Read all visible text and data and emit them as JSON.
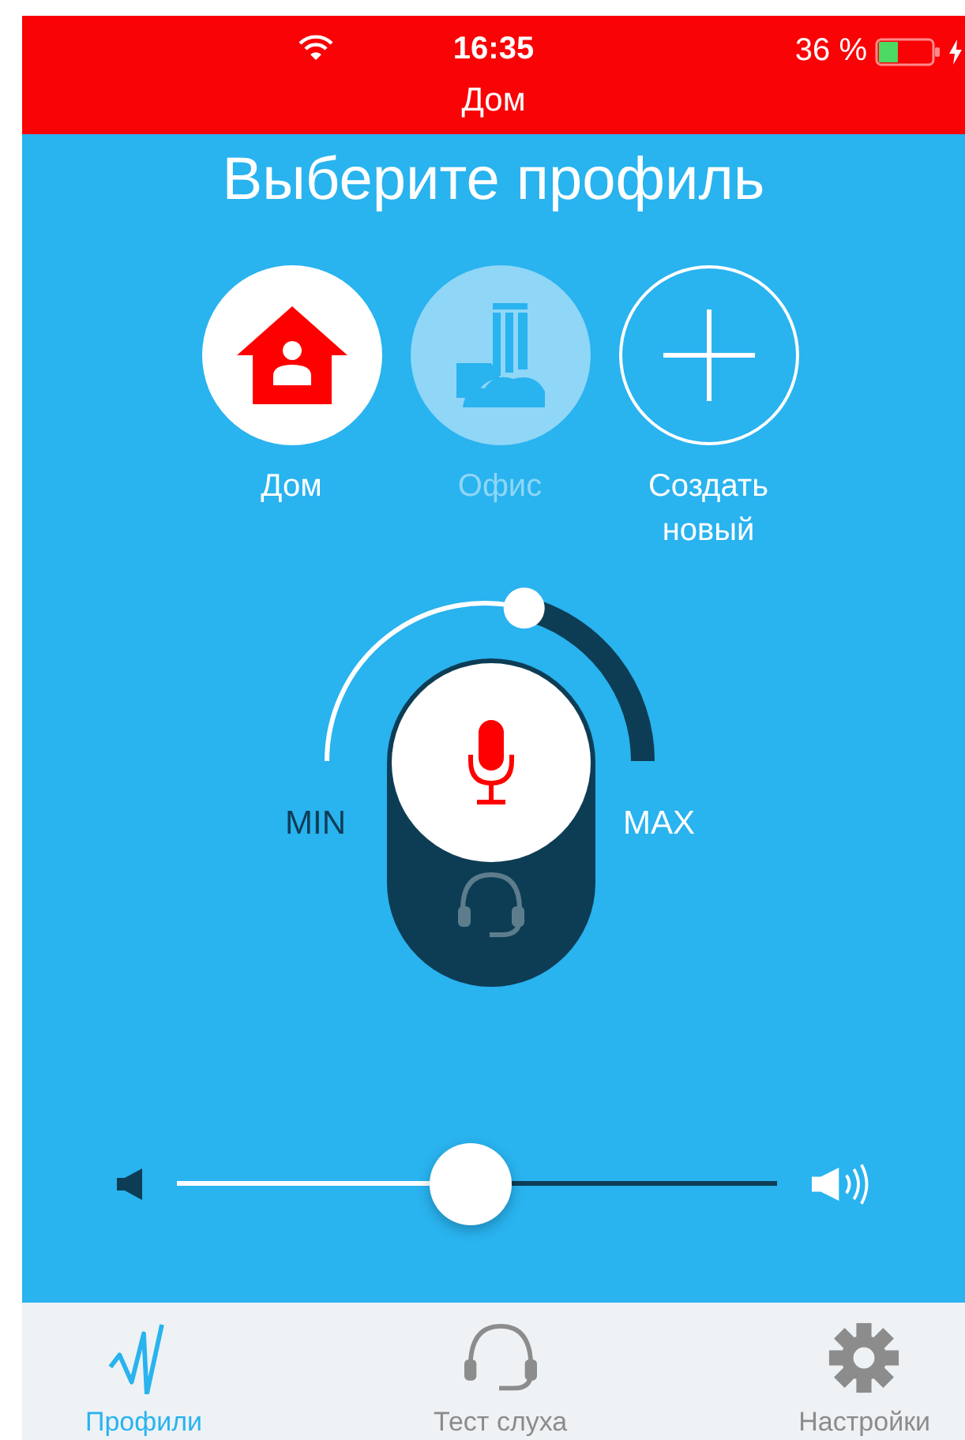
{
  "status_bar": {
    "time": "16:35",
    "battery": "36 %"
  },
  "header": {
    "title": "Дом"
  },
  "heading": "Выберите профиль",
  "profiles": [
    {
      "kind": "home",
      "label": "Дом",
      "selected": true
    },
    {
      "kind": "office",
      "label": "Офис",
      "selected": false
    },
    {
      "kind": "add",
      "label": "Создать новый",
      "selected": false
    }
  ],
  "dial": {
    "level": 0.58,
    "min_label": "MIN",
    "max_label": "MAX"
  },
  "modes": [
    {
      "kind": "mic",
      "selected": true
    },
    {
      "kind": "headset",
      "selected": false
    }
  ],
  "volume": {
    "level": 0.49
  },
  "tabs": [
    {
      "kind": "profiles",
      "label": "Профили",
      "selected": true
    },
    {
      "kind": "hearing",
      "label": "Тест слуха",
      "selected": false
    },
    {
      "kind": "settings",
      "label": "Настройки",
      "selected": false
    }
  ]
}
